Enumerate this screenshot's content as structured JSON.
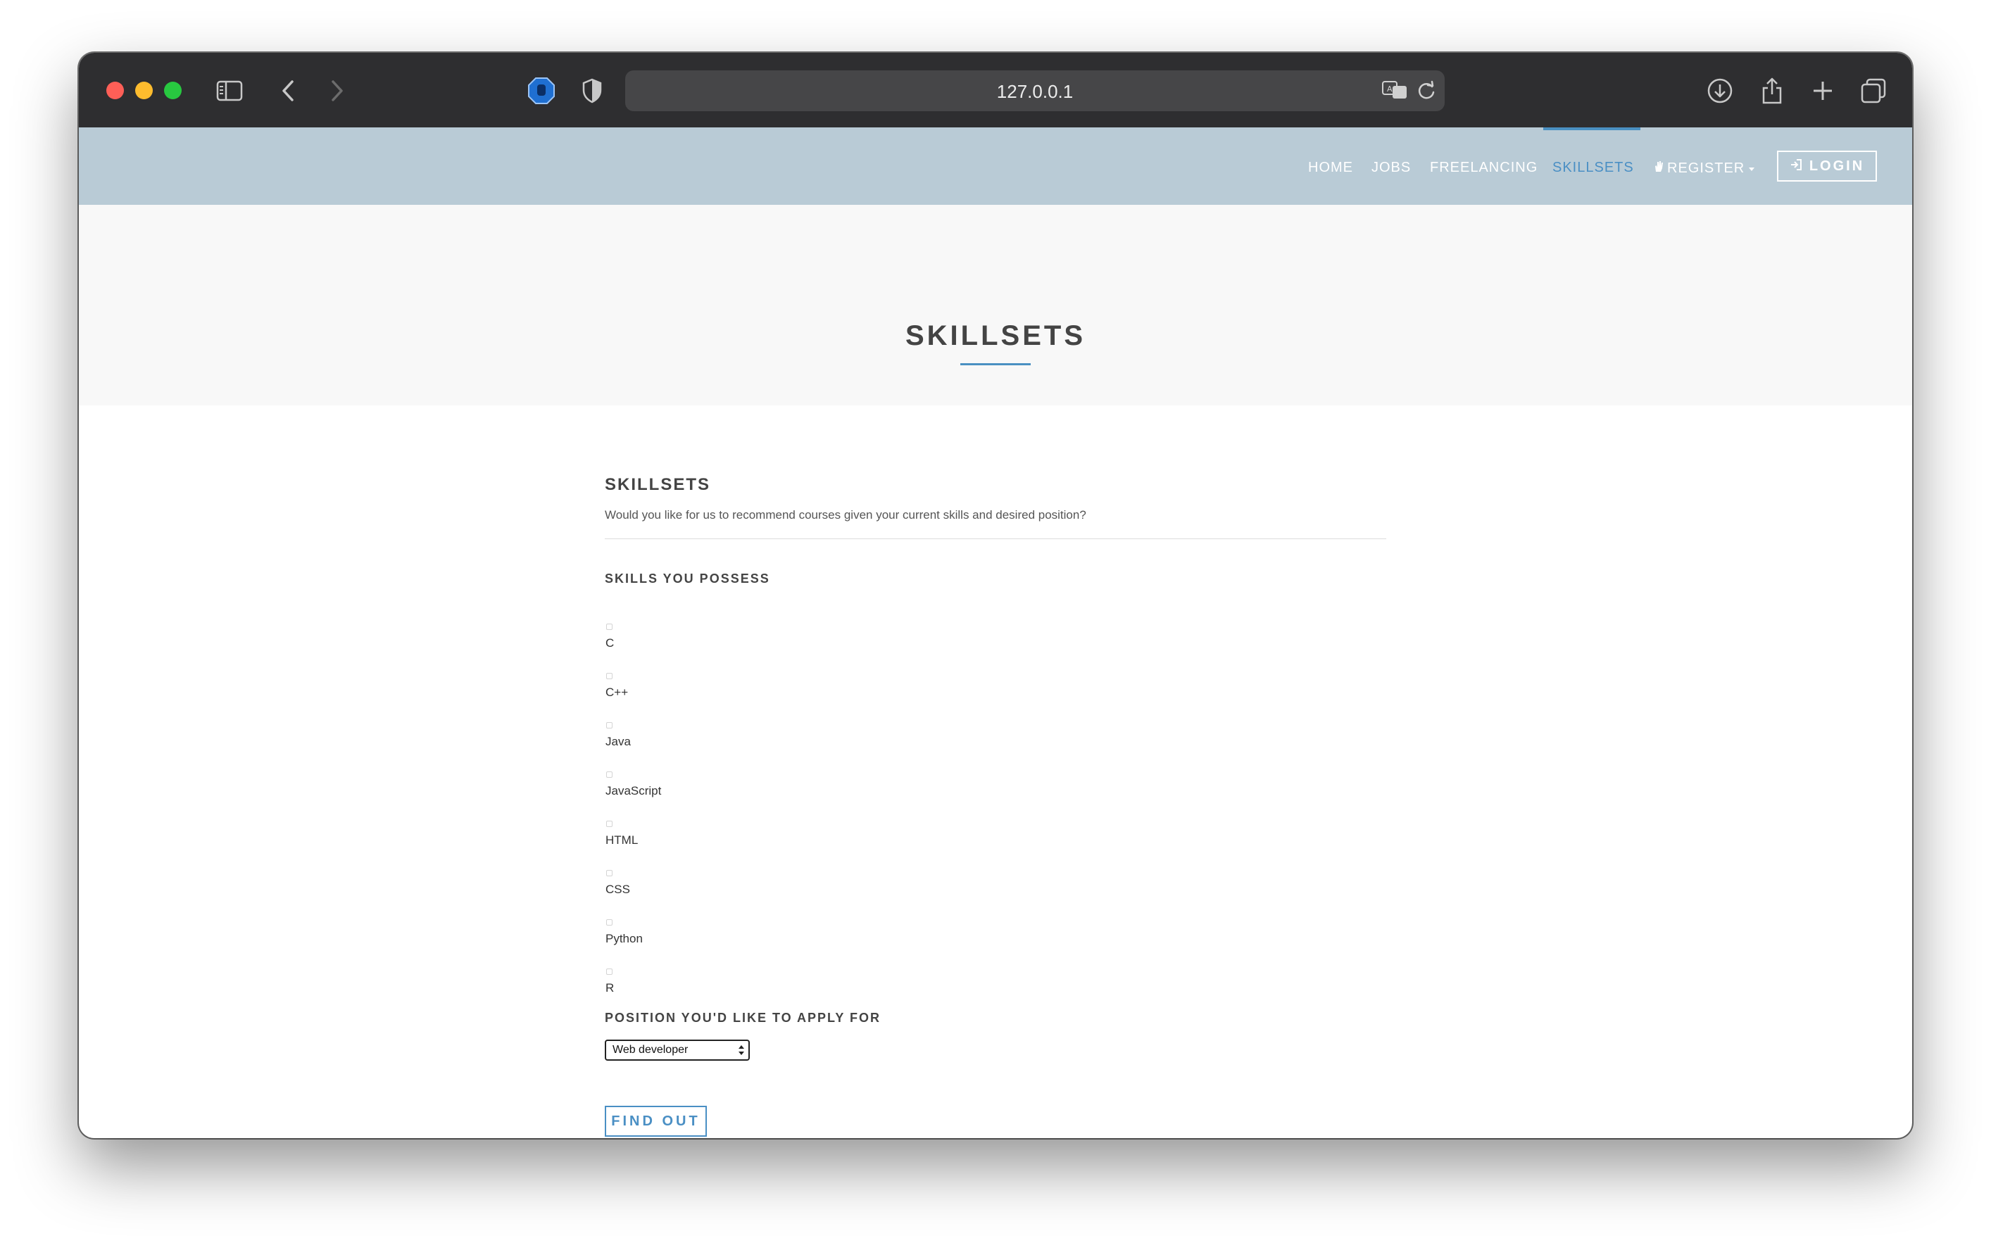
{
  "browser": {
    "url": "127.0.0.1"
  },
  "nav": {
    "items": [
      {
        "label": "HOME"
      },
      {
        "label": "JOBS"
      },
      {
        "label": "FREELANCING"
      },
      {
        "label": "SKILLSETS",
        "active": true
      },
      {
        "label": "REGISTER"
      }
    ],
    "login_label": "LOGIN"
  },
  "hero": {
    "title": "SKILLSETS"
  },
  "form": {
    "title": "SKILLSETS",
    "description": "Would you like for us to recommend courses given your current skills and desired position?",
    "skills_label": "SKILLS YOU POSSESS",
    "skills": [
      "C",
      "C++",
      "Java",
      "JavaScript",
      "HTML",
      "CSS",
      "Python",
      "R"
    ],
    "position_label": "POSITION YOU'D LIKE TO APPLY FOR",
    "position_selected": "Web developer",
    "submit_label": "FIND OUT"
  },
  "colors": {
    "navbar_bg": "#b9cbd6",
    "accent": "#4a8fc4",
    "toolbar_bg": "#2e2e30"
  }
}
